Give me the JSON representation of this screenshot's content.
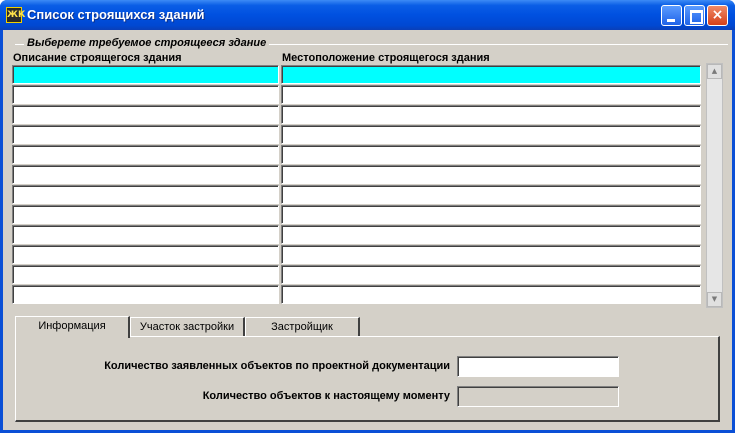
{
  "window": {
    "title": "Список строящихся зданий",
    "icon_glyph": "ЖК",
    "icon": "app-icon",
    "controls": {
      "minimize": "minimize-icon",
      "maximize": "maximize-icon",
      "close": "×"
    }
  },
  "group": {
    "label": "Выберете требуемое строящееся здание"
  },
  "table": {
    "columns": [
      "Описание строящегося здания",
      "Местоположение строящегося здания"
    ],
    "rows": [
      {
        "description": "",
        "location": "",
        "selected": true
      },
      {
        "description": "",
        "location": "",
        "selected": false
      },
      {
        "description": "",
        "location": "",
        "selected": false
      },
      {
        "description": "",
        "location": "",
        "selected": false
      },
      {
        "description": "",
        "location": "",
        "selected": false
      },
      {
        "description": "",
        "location": "",
        "selected": false
      },
      {
        "description": "",
        "location": "",
        "selected": false
      },
      {
        "description": "",
        "location": "",
        "selected": false
      },
      {
        "description": "",
        "location": "",
        "selected": false
      },
      {
        "description": "",
        "location": "",
        "selected": false
      },
      {
        "description": "",
        "location": "",
        "selected": false
      },
      {
        "description": "",
        "location": "",
        "selected": false
      }
    ],
    "selected_color": "#00ffff",
    "scrollbar": {
      "up": "▲",
      "down": "▼"
    }
  },
  "tabs": [
    {
      "label": "Информация",
      "active": true
    },
    {
      "label": "Участок застройки",
      "active": false
    },
    {
      "label": "Застройщик",
      "active": false
    }
  ],
  "info": {
    "declared_label": "Количество заявленных объектов по проектной документации",
    "declared_value": "",
    "current_label": "Количество объектов к настоящему моменту",
    "current_value": ""
  },
  "colors": {
    "titlebar": "#0050e0",
    "panel": "#d4d0c8"
  }
}
